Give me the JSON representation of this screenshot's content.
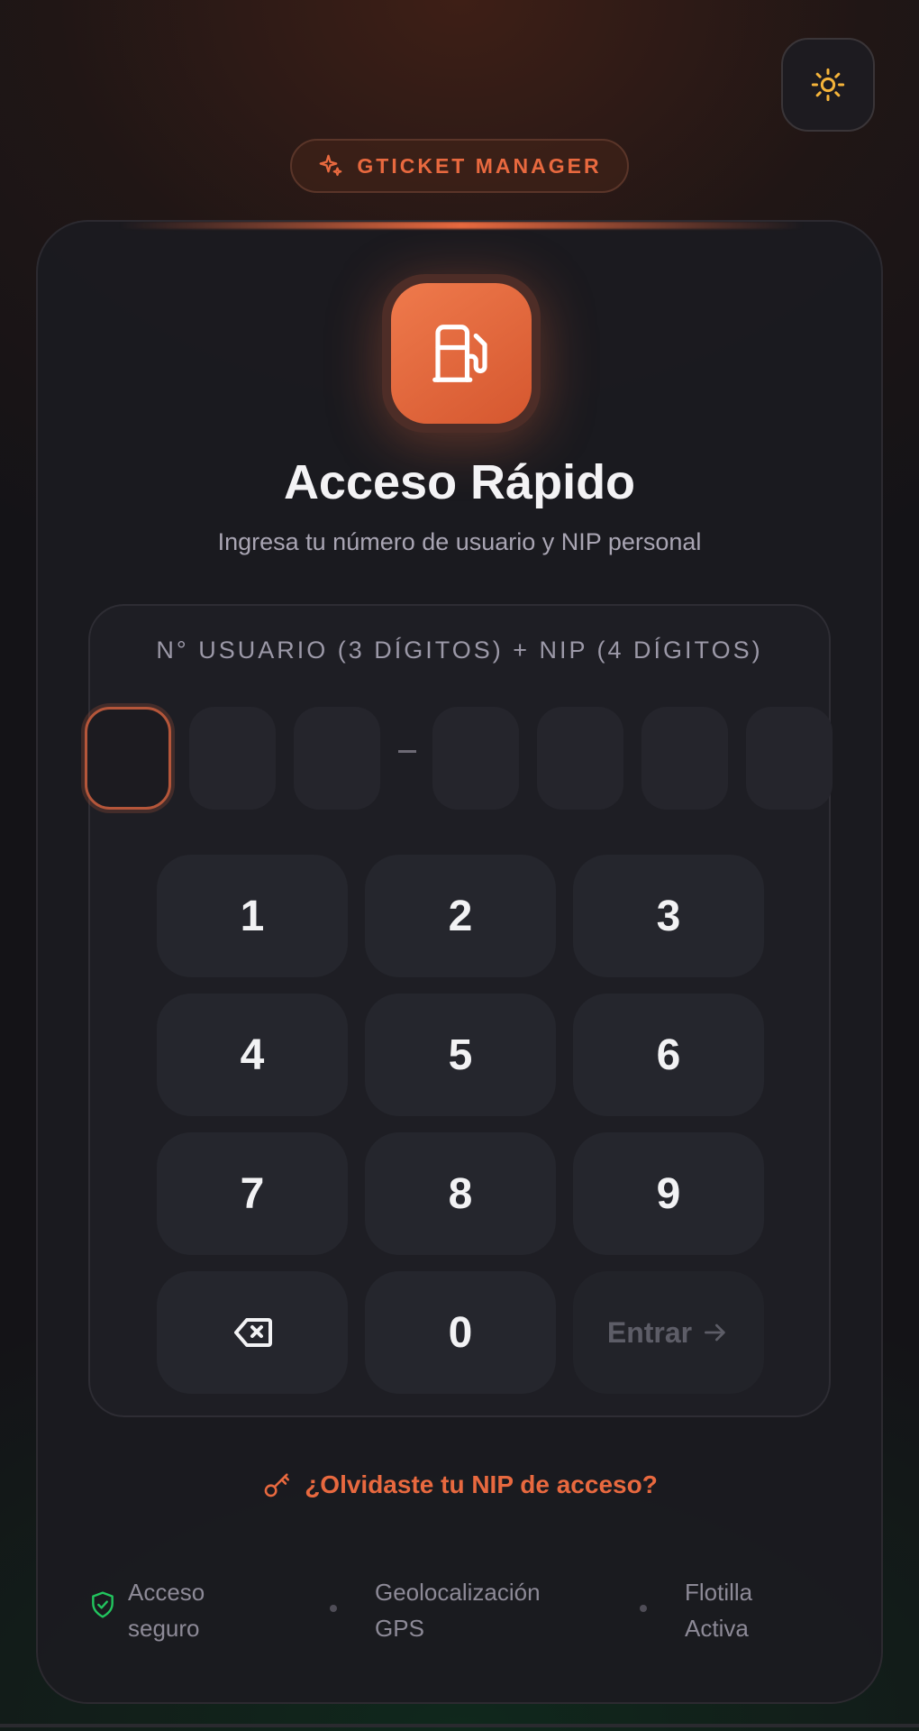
{
  "app": {
    "badge": "GTICKET MANAGER",
    "title": "Acceso Rápido",
    "subtitle": "Ingresa tu número de usuario y NIP personal"
  },
  "theme_toggle": {
    "icon": "sun-icon"
  },
  "logo": {
    "icon": "fuel-pump-icon"
  },
  "pin_entry": {
    "label": "N° USUARIO (3 DÍGITOS) + NIP (4 DÍGITOS)",
    "separator": "-",
    "user_digits": [
      "",
      "",
      ""
    ],
    "pin_digits": [
      "",
      "",
      "",
      ""
    ],
    "active_slot": 0
  },
  "keypad": {
    "keys": [
      "1",
      "2",
      "3",
      "4",
      "5",
      "6",
      "7",
      "8",
      "9"
    ],
    "zero": "0",
    "backspace_icon": "backspace-icon",
    "enter_label": "Entrar",
    "enter_icon": "arrow-right-icon"
  },
  "forgot": {
    "label": "¿Olvidaste tu NIP de acceso?",
    "icon": "key-icon"
  },
  "features": [
    {
      "line1": "Acceso",
      "line2": "seguro",
      "icon": "shield-check-icon"
    },
    {
      "line1": "Geolocalización",
      "line2": "GPS"
    },
    {
      "line1": "Flotilla",
      "line2": "Activa"
    }
  ],
  "colors": {
    "accent": "#e8693f",
    "success": "#22c55e",
    "sun": "#f5b43a"
  }
}
